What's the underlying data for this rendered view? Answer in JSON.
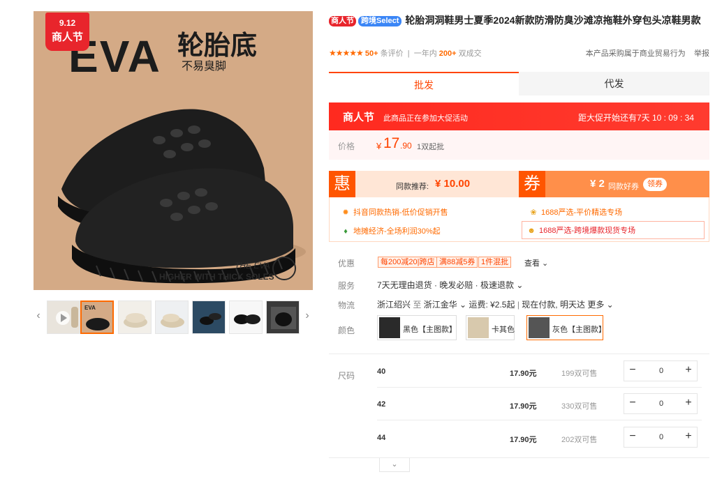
{
  "gallery": {
    "promo_date": "9.12",
    "promo_name": "商人节",
    "headline": "EVA",
    "headline2": "轮胎底",
    "subline": "不易臭脚",
    "footer1": "THE EVA",
    "footer2": "HIGHER WITH THICK SOLES",
    "thumb1_tag": "EVA 轮胎底",
    "prev_icon": "chevron-left-icon",
    "next_icon": "chevron-right-icon"
  },
  "product": {
    "badge_festival": "商人节",
    "badge_select": "跨境Select",
    "title": "轮胎洞洞鞋男士夏季2024新款防滑防臭沙滩凉拖鞋外穿包头凉鞋男款",
    "stars": "★★★★★",
    "review_count": "50+",
    "review_label": "条评价",
    "sales_prefix": "一年内",
    "sales_count": "200+",
    "sales_label": "双成交",
    "notice": "本产品采购属于商业贸易行为",
    "report": "举报"
  },
  "tabs": {
    "wholesale": "批发",
    "dropship": "代发"
  },
  "promo": {
    "name": "商人节",
    "desc": "此商品正在参加大促活动",
    "countdown": "距大促开始还有7天 10 : 09 : 34"
  },
  "price": {
    "label": "价格",
    "currency": "¥",
    "value": "17",
    "decimal": ".90",
    "moq": "1双起批"
  },
  "deal": {
    "hui_icon": "惠",
    "hui_text": "同款推荐:",
    "hui_value": "¥ 10.00",
    "quan_icon": "券",
    "quan_value": "¥ 2",
    "quan_text": "同款好券",
    "quan_button": "领券"
  },
  "features": [
    {
      "icon": "✹",
      "text": "抖音同款热销-低价促销开售"
    },
    {
      "icon": "❀",
      "text": "1688严选-平价精选专场"
    },
    {
      "icon": "♦",
      "text": "地摊经济-全场利润30%起"
    },
    {
      "icon": "☻",
      "text": "1688严选-跨境爆款现货专场"
    }
  ],
  "offers": {
    "label": "优惠",
    "coupons": [
      "每200减20|跨店",
      "满88减5券",
      "1件混批"
    ],
    "check": "查看 ⌄"
  },
  "service": {
    "label": "服务",
    "text": "7天无理由退货 · 晚发必赔 · 极速退款 ⌄"
  },
  "logistics": {
    "label": "物流",
    "from": "浙江绍兴",
    "to_word": "至",
    "to": "浙江金华 ⌄",
    "fee": "运费: ¥2.5起",
    "sep": "|",
    "eta": "现在付款, 明天达",
    "more": "更多 ⌄"
  },
  "colors": {
    "label": "颜色",
    "options": [
      {
        "name": "黑色【主图款】",
        "swatch": "#2a2a2a"
      },
      {
        "name": "卡其色",
        "swatch": "#d8c9ad"
      },
      {
        "name": "灰色【主图款】",
        "swatch": "#555555"
      }
    ]
  },
  "sizes": {
    "label": "尺码",
    "rows": [
      {
        "size": "40",
        "price": "17.90元",
        "avail": "199双可售",
        "qty": "0"
      },
      {
        "size": "42",
        "price": "17.90元",
        "avail": "330双可售",
        "qty": "0"
      },
      {
        "size": "44",
        "price": "17.90元",
        "avail": "202双可售",
        "qty": "0"
      }
    ],
    "minus": "−",
    "plus": "+"
  },
  "expand_icon": "chevron-down-icon"
}
